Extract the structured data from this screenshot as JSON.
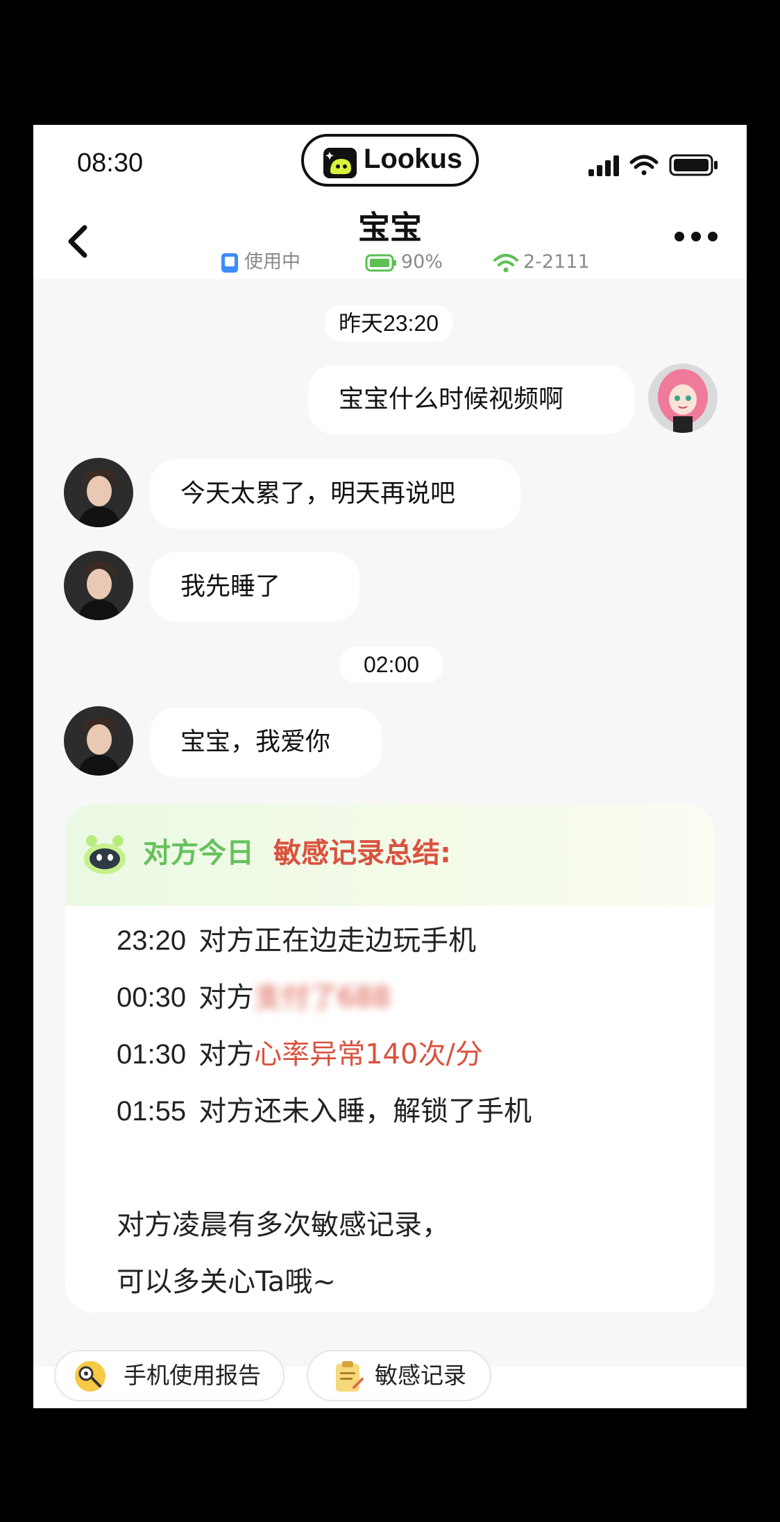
{
  "status_bar": {
    "time": "08:30"
  },
  "app": {
    "name": "Lookus"
  },
  "header": {
    "contact_name": "宝宝",
    "device_state": "使用中",
    "battery": "90%",
    "network": "2-2111"
  },
  "chat": {
    "timestamps": [
      "昨天23:20",
      "02:00"
    ],
    "messages": [
      {
        "from": "me",
        "text": "宝宝什么时候视频啊"
      },
      {
        "from": "contact",
        "text": "今天太累了，明天再说吧"
      },
      {
        "from": "contact",
        "text": "我先睡了"
      },
      {
        "from": "contact",
        "text": "宝宝，我爱你"
      }
    ]
  },
  "summary": {
    "title_green": "对方今日",
    "title_red": "敏感记录总结:",
    "records": [
      {
        "time": "23:20",
        "prefix": "对方正在边走边玩手机",
        "highlight": "",
        "blurred": ""
      },
      {
        "time": "00:30",
        "prefix": "对方",
        "highlight": "",
        "blurred": "支付了688"
      },
      {
        "time": "01:30",
        "prefix": "对方",
        "highlight": "心率异常140次/分",
        "blurred": ""
      },
      {
        "time": "01:55",
        "prefix": "对方还未入睡，解锁了手机",
        "highlight": "",
        "blurred": ""
      }
    ],
    "note_line1": "对方凌晨有多次敏感记录，",
    "note_line2": "可以多关心Ta哦~"
  },
  "actions": {
    "report_label": "手机使用报告",
    "sensitive_label": "敏感记录"
  },
  "colors": {
    "green": "#66c15c",
    "red": "#d9523f",
    "accent_blue": "#3d8bfd"
  }
}
